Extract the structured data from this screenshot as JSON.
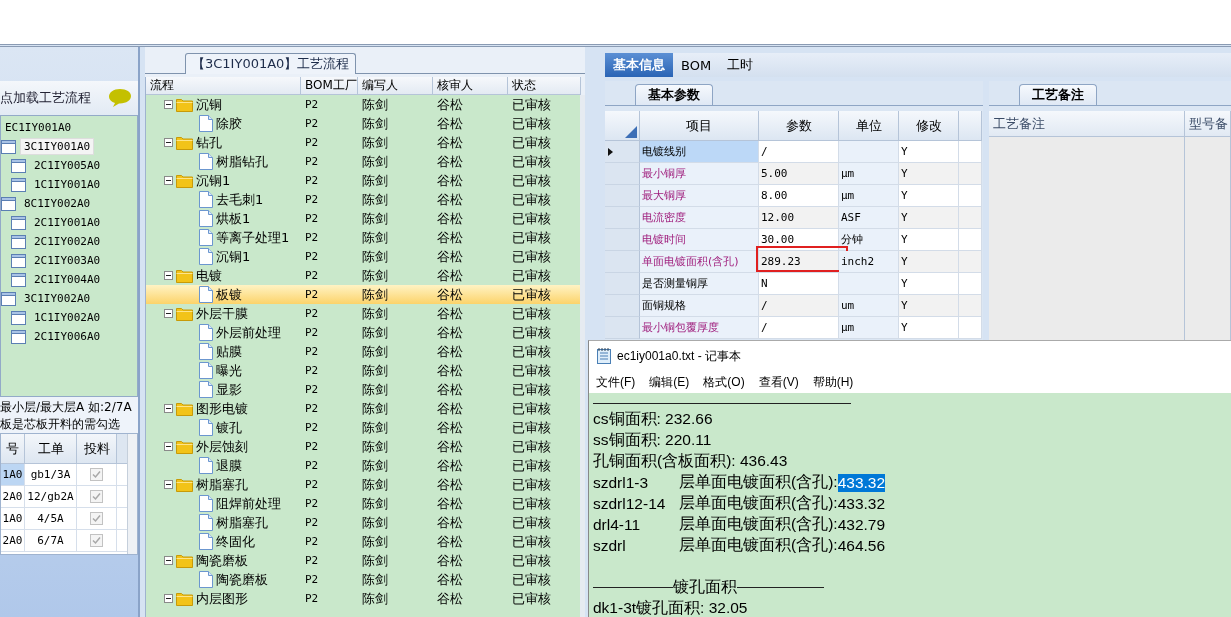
{
  "left_panel": {
    "header": "点加载工艺流程",
    "tree": [
      {
        "label": "EC1IY001A0",
        "selected": false,
        "children": [
          {
            "label": "3C1IY001A0",
            "selected": true,
            "children": [
              {
                "label": "2C1IY005A0",
                "selected": false
              },
              {
                "label": "1C1IY001A0",
                "selected": false
              }
            ]
          },
          {
            "label": "8C1IY002A0",
            "selected": false,
            "children": [
              {
                "label": "2C1IY001A0",
                "selected": false
              },
              {
                "label": "2C1IY002A0",
                "selected": false
              },
              {
                "label": "2C1IY003A0",
                "selected": false
              },
              {
                "label": "2C1IY004A0",
                "selected": false
              }
            ]
          },
          {
            "label": "3C1IY002A0",
            "selected": false,
            "children": [
              {
                "label": "1C1IY002A0",
                "selected": false
              },
              {
                "label": "2C1IY006A0",
                "selected": false
              }
            ]
          }
        ]
      }
    ],
    "note_lines": [
      "最小层/最大层A 如:2/7A",
      "板是芯板开料的需勾选"
    ],
    "grid": {
      "columns": [
        "号",
        "工单",
        "投料"
      ],
      "rows": [
        {
          "cells": [
            "1A0",
            "gb1/3A"
          ],
          "checked": true,
          "selected": true
        },
        {
          "cells": [
            "2A0",
            "12/gb2A"
          ],
          "checked": true,
          "selected": false
        },
        {
          "cells": [
            "1A0",
            "4/5A"
          ],
          "checked": true,
          "selected": false
        },
        {
          "cells": [
            "2A0",
            "6/7A"
          ],
          "checked": true,
          "selected": false
        }
      ]
    }
  },
  "flow": {
    "title": "【3C1IY001A0】工艺流程",
    "columns": [
      "流程",
      "BOM工厂",
      "编写人",
      "核审人",
      "状态"
    ],
    "steps": [
      {
        "name": "沉铜",
        "bom": "P2",
        "writer": "陈剑",
        "reviewer": "谷松",
        "status": "已审核",
        "selected": false,
        "expanded": true,
        "children": [
          {
            "name": "除胶",
            "bom": "P2",
            "writer": "陈剑",
            "reviewer": "谷松",
            "status": "已审核",
            "selected": false
          }
        ]
      },
      {
        "name": "钻孔",
        "bom": "P2",
        "writer": "陈剑",
        "reviewer": "谷松",
        "status": "已审核",
        "selected": false,
        "expanded": true,
        "children": [
          {
            "name": "树脂钻孔",
            "bom": "P2",
            "writer": "陈剑",
            "reviewer": "谷松",
            "status": "已审核",
            "selected": false
          }
        ]
      },
      {
        "name": "沉铜1",
        "bom": "P2",
        "writer": "陈剑",
        "reviewer": "谷松",
        "status": "已审核",
        "selected": false,
        "expanded": true,
        "children": [
          {
            "name": "去毛刺1",
            "bom": "P2",
            "writer": "陈剑",
            "reviewer": "谷松",
            "status": "已审核",
            "selected": false
          },
          {
            "name": "烘板1",
            "bom": "P2",
            "writer": "陈剑",
            "reviewer": "谷松",
            "status": "已审核",
            "selected": false
          },
          {
            "name": "等离子处理1",
            "bom": "P2",
            "writer": "陈剑",
            "reviewer": "谷松",
            "status": "已审核",
            "selected": false
          },
          {
            "name": "沉铜1",
            "bom": "P2",
            "writer": "陈剑",
            "reviewer": "谷松",
            "status": "已审核",
            "selected": false
          }
        ]
      },
      {
        "name": "电镀",
        "bom": "P2",
        "writer": "陈剑",
        "reviewer": "谷松",
        "status": "已审核",
        "selected": false,
        "expanded": true,
        "children": [
          {
            "name": "板镀",
            "bom": "P2",
            "writer": "陈剑",
            "reviewer": "谷松",
            "status": "已审核",
            "selected": true
          }
        ]
      },
      {
        "name": "外层干膜",
        "bom": "P2",
        "writer": "陈剑",
        "reviewer": "谷松",
        "status": "已审核",
        "selected": false,
        "expanded": true,
        "children": [
          {
            "name": "外层前处理",
            "bom": "P2",
            "writer": "陈剑",
            "reviewer": "谷松",
            "status": "已审核",
            "selected": false
          },
          {
            "name": "贴膜",
            "bom": "P2",
            "writer": "陈剑",
            "reviewer": "谷松",
            "status": "已审核",
            "selected": false
          },
          {
            "name": "曝光",
            "bom": "P2",
            "writer": "陈剑",
            "reviewer": "谷松",
            "status": "已审核",
            "selected": false
          },
          {
            "name": "显影",
            "bom": "P2",
            "writer": "陈剑",
            "reviewer": "谷松",
            "status": "已审核",
            "selected": false
          }
        ]
      },
      {
        "name": "图形电镀",
        "bom": "P2",
        "writer": "陈剑",
        "reviewer": "谷松",
        "status": "已审核",
        "selected": false,
        "expanded": true,
        "children": [
          {
            "name": "镀孔",
            "bom": "P2",
            "writer": "陈剑",
            "reviewer": "谷松",
            "status": "已审核",
            "selected": false
          }
        ]
      },
      {
        "name": "外层蚀刻",
        "bom": "P2",
        "writer": "陈剑",
        "reviewer": "谷松",
        "status": "已审核",
        "selected": false,
        "expanded": true,
        "children": [
          {
            "name": "退膜",
            "bom": "P2",
            "writer": "陈剑",
            "reviewer": "谷松",
            "status": "已审核",
            "selected": false
          }
        ]
      },
      {
        "name": "树脂塞孔",
        "bom": "P2",
        "writer": "陈剑",
        "reviewer": "谷松",
        "status": "已审核",
        "selected": false,
        "expanded": true,
        "children": [
          {
            "name": "阻焊前处理",
            "bom": "P2",
            "writer": "陈剑",
            "reviewer": "谷松",
            "status": "已审核",
            "selected": false
          },
          {
            "name": "树脂塞孔",
            "bom": "P2",
            "writer": "陈剑",
            "reviewer": "谷松",
            "status": "已审核",
            "selected": false
          },
          {
            "name": "终固化",
            "bom": "P2",
            "writer": "陈剑",
            "reviewer": "谷松",
            "status": "已审核",
            "selected": false
          }
        ]
      },
      {
        "name": "陶瓷磨板",
        "bom": "P2",
        "writer": "陈剑",
        "reviewer": "谷松",
        "status": "已审核",
        "selected": false,
        "expanded": true,
        "children": [
          {
            "name": "陶瓷磨板",
            "bom": "P2",
            "writer": "陈剑",
            "reviewer": "谷松",
            "status": "已审核",
            "selected": false
          }
        ]
      },
      {
        "name": "内层图形",
        "bom": "P2",
        "writer": "陈剑",
        "reviewer": "谷松",
        "status": "已审核",
        "selected": false,
        "expanded": true
      }
    ]
  },
  "detail": {
    "tabs": [
      {
        "label": "基本信息",
        "selected": true
      },
      {
        "label": "BOM",
        "selected": false
      },
      {
        "label": "工时",
        "selected": false
      }
    ],
    "params": {
      "tab": "基本参数",
      "columns": [
        "项目",
        "参数",
        "单位",
        "修改"
      ],
      "rows": [
        {
          "item": "电镀线别",
          "value": "/",
          "unit": "",
          "modified": "Y",
          "required": false,
          "current": true,
          "flagged": false
        },
        {
          "item": "最小铜厚",
          "value": "5.00",
          "unit": "μm",
          "modified": "Y",
          "required": true,
          "current": false,
          "flagged": false
        },
        {
          "item": "最大铜厚",
          "value": "8.00",
          "unit": "μm",
          "modified": "Y",
          "required": true,
          "current": false,
          "flagged": false
        },
        {
          "item": "电流密度",
          "value": "12.00",
          "unit": "ASF",
          "modified": "Y",
          "required": true,
          "current": false,
          "flagged": false
        },
        {
          "item": "电镀时间",
          "value": "30.00",
          "unit": "分钟",
          "modified": "Y",
          "required": true,
          "current": false,
          "flagged": false
        },
        {
          "item": "单面电镀面积(含孔)",
          "value": "289.23",
          "unit": "inch2",
          "modified": "Y",
          "required": true,
          "current": false,
          "flagged": true
        },
        {
          "item": "是否测量铜厚",
          "value": "N",
          "unit": "",
          "modified": "Y",
          "required": false,
          "current": false,
          "flagged": false
        },
        {
          "item": "面铜规格",
          "value": "/",
          "unit": "um",
          "modified": "Y",
          "required": false,
          "current": false,
          "flagged": false
        },
        {
          "item": "最小铜包覆厚度",
          "value": "/",
          "unit": "μm",
          "modified": "Y",
          "required": true,
          "current": false,
          "flagged": false
        }
      ]
    },
    "notes": {
      "tab": "工艺备注",
      "columns": [
        "工艺备注",
        "型号备"
      ]
    }
  },
  "notepad": {
    "title": "ec1iy001a0.txt - 记事本",
    "menu": [
      "文件(F)",
      "编辑(E)",
      "格式(O)",
      "查看(V)",
      "帮助(H)"
    ],
    "lines": [
      {
        "kind": "rule"
      },
      {
        "kind": "text",
        "text": "cs铜面积: 232.66"
      },
      {
        "kind": "text",
        "text": "ss铜面积: 220.11"
      },
      {
        "kind": "text",
        "text": "孔铜面积(含板面积): 436.43"
      },
      {
        "kind": "entry",
        "code": "szdrl1-3",
        "label": "层单面电镀面积(含孔):",
        "value": "433.32",
        "selected": true
      },
      {
        "kind": "entry",
        "code": "szdrl12-14",
        "label": "层单面电镀面积(含孔):",
        "value": "433.32",
        "selected": false
      },
      {
        "kind": "entry",
        "code": "drl4-11",
        "label": "层单面电镀面积(含孔):",
        "value": "432.79",
        "selected": false
      },
      {
        "kind": "entry",
        "code": "szdrl",
        "label": "层单面电镀面积(含孔):",
        "value": "464.56",
        "selected": false
      },
      {
        "kind": "blank"
      },
      {
        "kind": "heading",
        "text": "镀孔面积"
      },
      {
        "kind": "text",
        "text": "dk1-3t镀孔面积: 32.05"
      }
    ]
  }
}
